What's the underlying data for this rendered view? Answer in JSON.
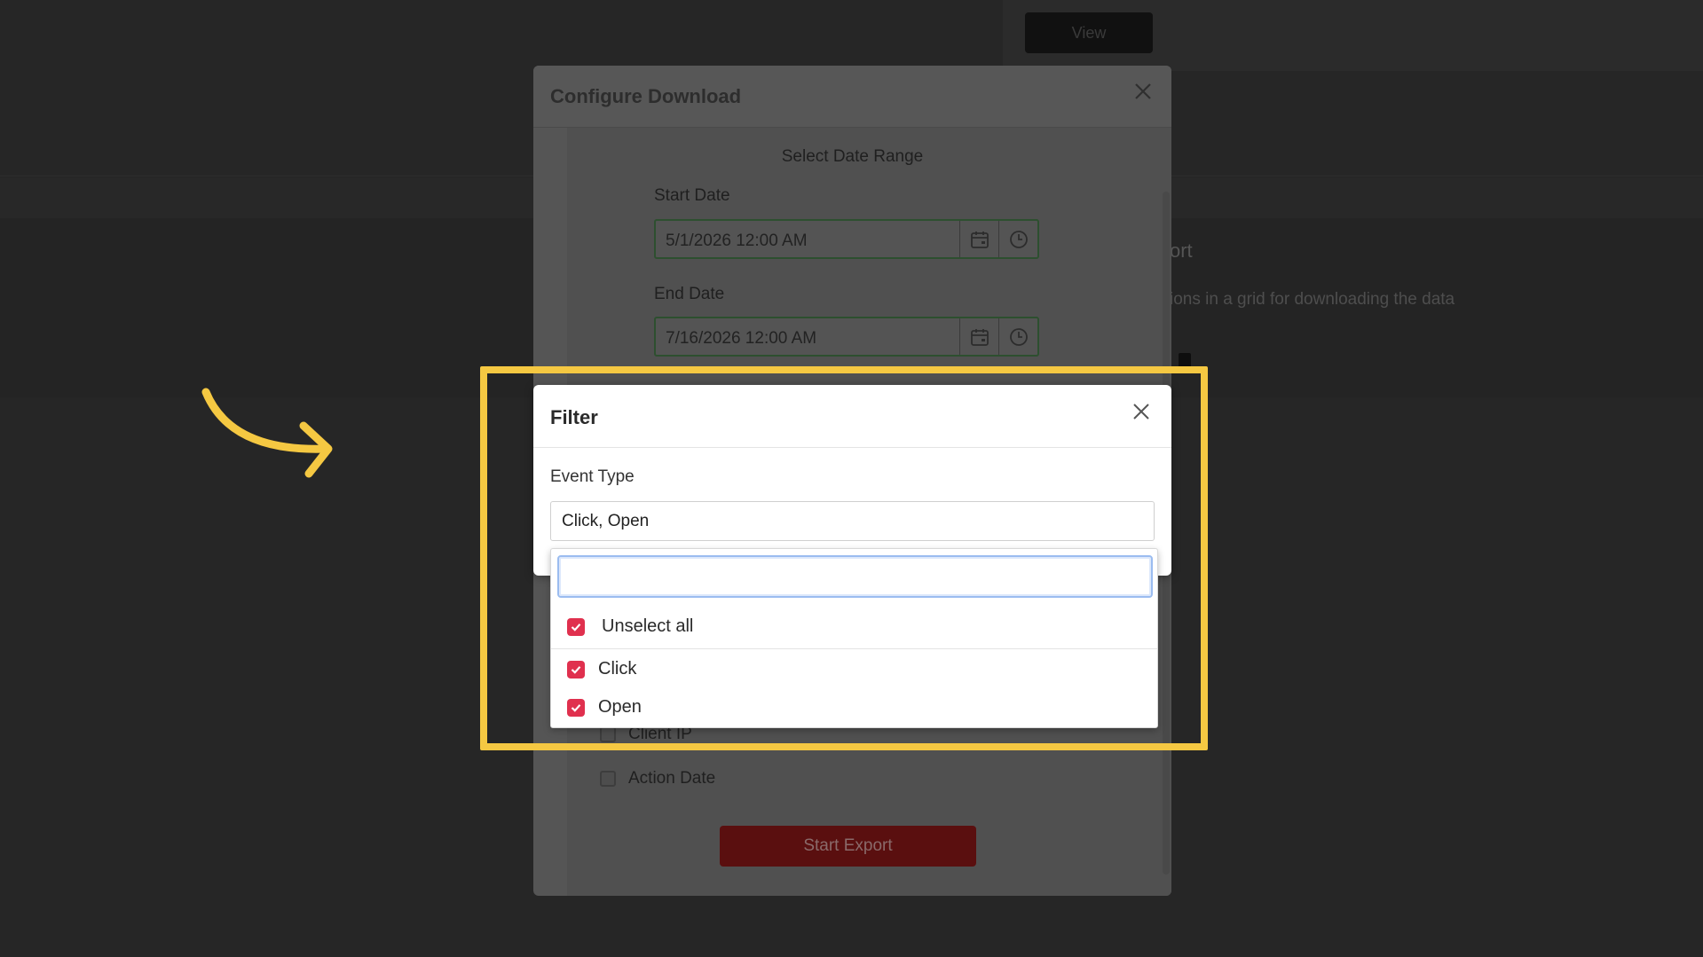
{
  "background": {
    "view_button": "View",
    "export_title": "ort",
    "export_description": "ions in a grid for downloading the data"
  },
  "configure_modal": {
    "title": "Configure Download",
    "range_label": "Select Date Range",
    "start_label": "Start Date",
    "start_value": "5/1/2026 12:00 AM",
    "end_label": "End Date",
    "end_value": "7/16/2026 12:00 AM",
    "fields": [
      {
        "label": "Client IP",
        "checked": false
      },
      {
        "label": "Action Date",
        "checked": false
      }
    ],
    "export_button": "Start Export"
  },
  "filter_modal": {
    "title": "Filter",
    "event_type_label": "Event Type",
    "selected_value": "Click, Open",
    "search_value": "",
    "options": [
      {
        "label": "Unselect all",
        "checked": true
      },
      {
        "label": "Click",
        "checked": true
      },
      {
        "label": "Open",
        "checked": true
      }
    ]
  },
  "colors": {
    "highlight": "#f5c842",
    "checkbox_accent": "#e0304e",
    "search_focus": "#9bbcf0"
  },
  "icons": {
    "close": "close-icon",
    "calendar": "calendar-icon",
    "clock": "clock-icon",
    "check": "check-icon",
    "arrow": "curved-arrow-icon"
  }
}
